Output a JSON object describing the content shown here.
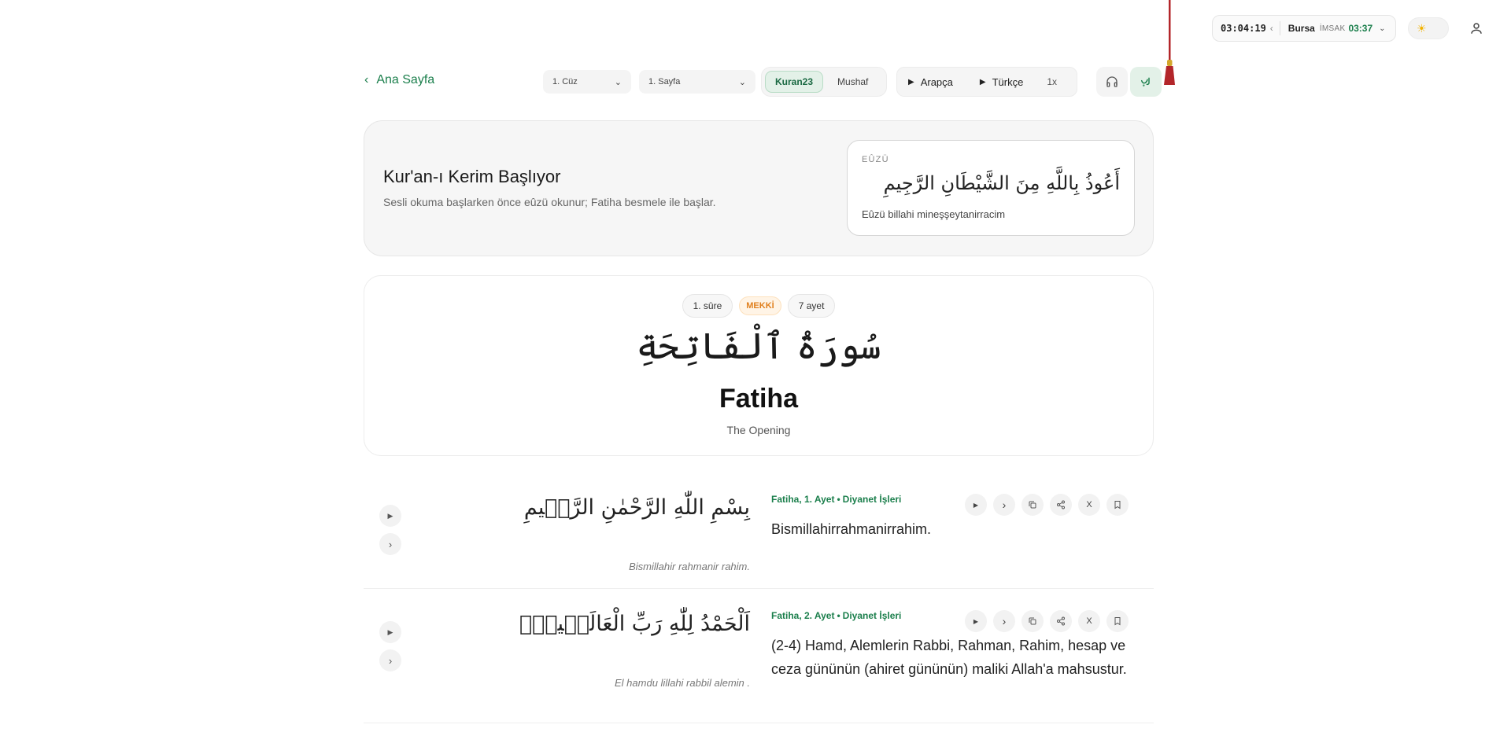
{
  "topbar": {
    "countdown": "03:04:19",
    "city": "Bursa",
    "prayer_label": "İMSAK",
    "prayer_time": "03:37",
    "theme_icon": "sun-icon",
    "user_icon": "user-icon"
  },
  "toolbar": {
    "back_label": "Ana Sayfa",
    "juz_select": "1. Cüz",
    "page_select": "1. Sayfa",
    "modes": [
      "Kuran23",
      "Mushaf"
    ],
    "active_mode": "Kuran23",
    "play_arabic": "Arapça",
    "play_turkish": "Türkçe",
    "speed": "1x",
    "accent": "#1b7f4c"
  },
  "intro": {
    "title": "Kur'an-ı Kerim Başlıyor",
    "subtitle": "Sesli okuma başlarken önce eûzü okunur; Fatiha besmele ile başlar.",
    "euzu_label": "EÛZÜ",
    "euzu_arabic": "أَعُوذُ بِاللَّهِ مِنَ الشَّيْطَانِ الرَّجِيمِ",
    "euzu_translit": "Eûzü billahi mineşşeytanirracim"
  },
  "surah": {
    "number_badge": "1. sûre",
    "type_badge": "MEKKİ",
    "verse_count_badge": "7 ayet",
    "arabic_name": "سُورَةُ ٱلْفَاتِحَةِ",
    "name": "Fatiha",
    "english_name": "The Opening"
  },
  "verses": [
    {
      "arabic": "بِسْمِ اللّٰهِ الرَّحْمٰنِ الرَّح۪يمِ",
      "translit": "Bismillahir rahmanir rahim.",
      "ref": "Fatiha, 1. Ayet",
      "source": "Diyanet İşleri",
      "meal": "Bismillahirrahmanirrahim.",
      "share_x": "X"
    },
    {
      "arabic": "اَلْحَمْدُ لِلّٰهِ رَبِّ الْعَالَم۪ينَۙ",
      "translit": "El hamdu lillahi rabbil alemin .",
      "ref": "Fatiha, 2. Ayet",
      "source": "Diyanet İşleri",
      "meal": "(2-4) Hamd, Alemlerin Rabbi, Rahman, Rahim, hesap ve ceza gününün (ahiret gününün) maliki Allah'a mahsustur.",
      "share_x": "X"
    }
  ]
}
